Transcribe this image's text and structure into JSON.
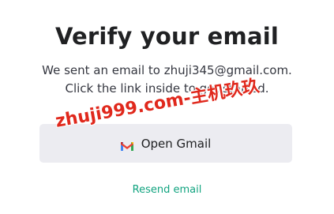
{
  "heading": "Verify your email",
  "description": {
    "line1": "We sent an email to zhuji345@gmail.com.",
    "line2": "Click the link inside to get started."
  },
  "open_gmail_button": {
    "label": "Open Gmail",
    "icon": "gmail-icon"
  },
  "resend_link": "Resend email",
  "watermark_text": "zhuji999.com-主机玖玖",
  "colors": {
    "heading": "#202123",
    "body_text": "#353740",
    "button_bg": "#ececf1",
    "link": "#10a37f",
    "watermark": "#e0281c"
  }
}
